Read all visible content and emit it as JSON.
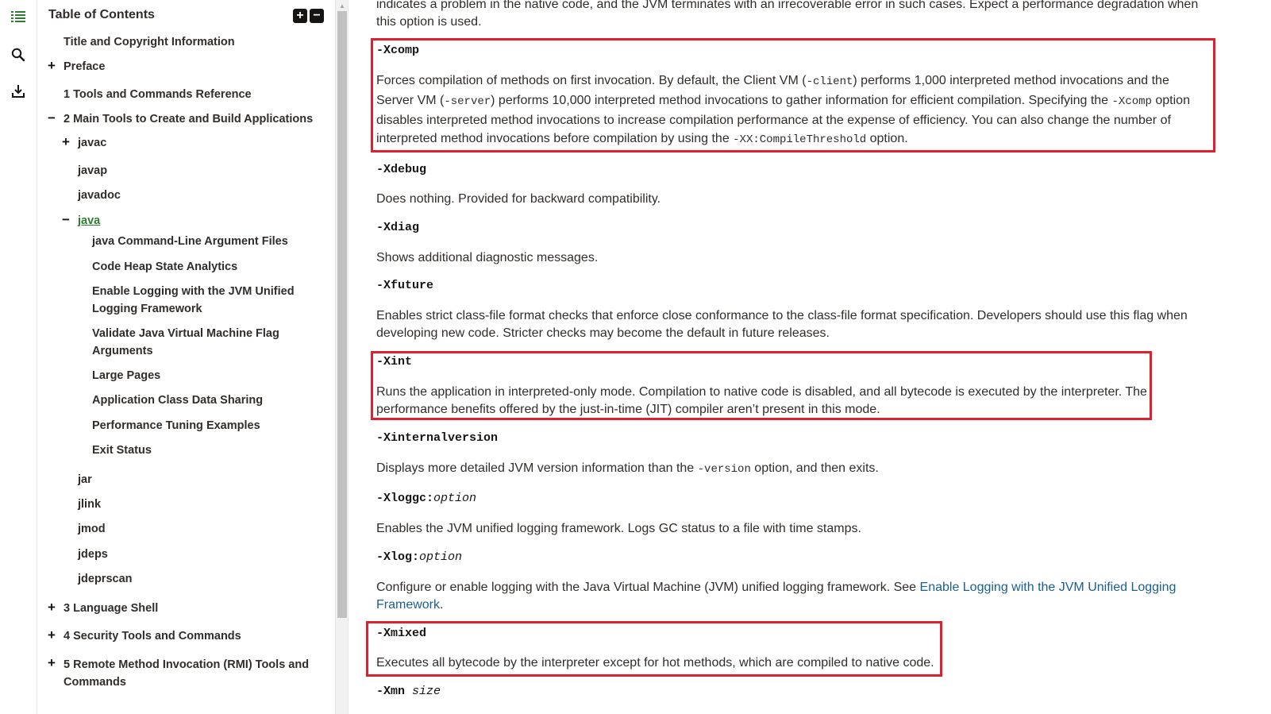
{
  "toc": {
    "title": "Table of Contents",
    "expand_all": "+",
    "collapse_all": "−",
    "items": [
      {
        "label": "Title and Copyright Information"
      },
      {
        "label": "Preface"
      },
      {
        "label": "1 Tools and Commands Reference"
      },
      {
        "label": "2 Main Tools to Create and Build Applications"
      },
      {
        "label": "javac"
      },
      {
        "label": "javap"
      },
      {
        "label": "javadoc"
      },
      {
        "label": "java"
      },
      {
        "label": "java Command-Line Argument Files"
      },
      {
        "label": "Code Heap State Analytics"
      },
      {
        "label": "Enable Logging with the JVM Unified"
      },
      {
        "label": "Logging Framework"
      },
      {
        "label": "Validate Java Virtual Machine Flag"
      },
      {
        "label": "Arguments"
      },
      {
        "label": "Large Pages"
      },
      {
        "label": "Application Class Data Sharing"
      },
      {
        "label": "Performance Tuning Examples"
      },
      {
        "label": "Exit Status"
      },
      {
        "label": "jar"
      },
      {
        "label": "jlink"
      },
      {
        "label": "jmod"
      },
      {
        "label": "jdeps"
      },
      {
        "label": "jdeprscan"
      },
      {
        "label": "3 Language Shell"
      },
      {
        "label": "4 Security Tools and Commands"
      },
      {
        "label": "5 Remote Method Invocation (RMI) Tools and"
      },
      {
        "label": "Commands"
      }
    ],
    "toggles": {
      "plus": "+",
      "minus": "−"
    }
  },
  "content": {
    "top_line1": "indicates a problem in the native code, and the JVM terminates with an irrecoverable error in such cases. Expect a performance degradation when",
    "top_line2": "this option is used.",
    "xcomp": {
      "name": "-Xcomp",
      "l1a": "Forces compilation of methods on first invocation. By default, the Client VM (",
      "l1code": "-client",
      "l1b": ") performs 1,000 interpreted method invocations and the",
      "l2a": "Server VM (",
      "l2code": "-server",
      "l2b": ") performs 10,000 interpreted method invocations to gather information for efficient compilation. Specifying the ",
      "l2code2": "-Xcomp",
      "l2c": " option",
      "l3": "disables interpreted method invocations to increase compilation performance at the expense of efficiency. You can also change the number of",
      "l4a": "interpreted method invocations before compilation by using the ",
      "l4code": "-XX:CompileThreshold",
      "l4b": " option."
    },
    "xdebug": {
      "name": "-Xdebug",
      "desc": "Does nothing. Provided for backward compatibility."
    },
    "xdiag": {
      "name": "-Xdiag",
      "desc": "Shows additional diagnostic messages."
    },
    "xfuture": {
      "name": "-Xfuture",
      "l1": "Enables strict class-file format checks that enforce close conformance to the class-file format specification. Developers should use this flag when",
      "l2": "developing new code. Stricter checks may become the default in future releases."
    },
    "xint": {
      "name": "-Xint",
      "l1": "Runs the application in interpreted-only mode. Compilation to native code is disabled, and all bytecode is executed by the interpreter. The",
      "l2": "performance benefits offered by the just-in-time (JIT) compiler aren’t present in this mode."
    },
    "xinternalversion": {
      "name": "-Xinternalversion",
      "d1": "Displays more detailed JVM version information than the ",
      "dcode": "-version",
      "d2": " option, and then exits."
    },
    "xloggc": {
      "name": "-Xloggc:",
      "arg": "option",
      "desc": "Enables the JVM unified logging framework. Logs GC status to a file with time stamps."
    },
    "xlog": {
      "name": "-Xlog:",
      "arg": "option",
      "d1": "Configure or enable logging with the Java Virtual Machine (JVM) unified logging framework. See ",
      "link1": "Enable Logging with the JVM Unified Logging",
      "link2": "Framework",
      "d2": "."
    },
    "xmixed": {
      "name": "-Xmixed",
      "desc": "Executes all bytecode by the interpreter except for hot methods, which are compiled to native code."
    },
    "xmn": {
      "name": "-Xmn ",
      "arg": "size"
    }
  },
  "colors": {
    "highlight": "#e0202e",
    "link": "#1a5f8f",
    "current": "#2e7d32"
  },
  "icons": [
    "toc-list-icon",
    "search-icon",
    "download-icon"
  ]
}
